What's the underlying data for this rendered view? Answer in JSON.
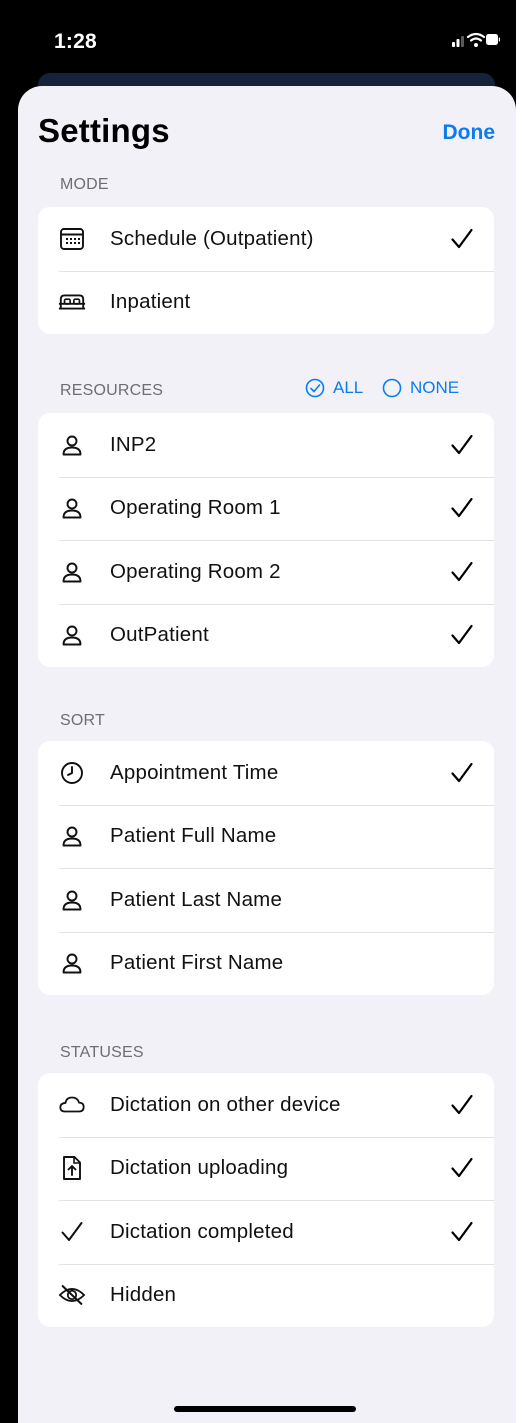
{
  "status_bar": {
    "time": "1:28"
  },
  "sheet": {
    "title": "Settings",
    "done_label": "Done"
  },
  "mode": {
    "header": "MODE",
    "items": [
      {
        "label": "Schedule (Outpatient)",
        "icon": "calendar-icon",
        "checked": true
      },
      {
        "label": "Inpatient",
        "icon": "bed-icon",
        "checked": false
      }
    ]
  },
  "resources": {
    "header": "RESOURCES",
    "all_label": "ALL",
    "none_label": "NONE",
    "items": [
      {
        "label": "INP2",
        "icon": "person-icon",
        "checked": true
      },
      {
        "label": "Operating Room 1",
        "icon": "person-icon",
        "checked": true
      },
      {
        "label": "Operating Room 2",
        "icon": "person-icon",
        "checked": true
      },
      {
        "label": "OutPatient",
        "icon": "person-icon",
        "checked": true
      }
    ]
  },
  "sort": {
    "header": "SORT",
    "items": [
      {
        "label": "Appointment Time",
        "icon": "clock-icon",
        "checked": true
      },
      {
        "label": "Patient Full Name",
        "icon": "person-icon",
        "checked": false
      },
      {
        "label": "Patient Last Name",
        "icon": "person-icon",
        "checked": false
      },
      {
        "label": "Patient First Name",
        "icon": "person-icon",
        "checked": false
      }
    ]
  },
  "statuses": {
    "header": "STATUSES",
    "items": [
      {
        "label": "Dictation on other device",
        "icon": "cloud-icon",
        "checked": true
      },
      {
        "label": "Dictation uploading",
        "icon": "upload-document-icon",
        "checked": true
      },
      {
        "label": "Dictation completed",
        "icon": "checkmark-icon",
        "checked": true
      },
      {
        "label": "Hidden",
        "icon": "eye-slash-icon",
        "checked": false
      }
    ]
  },
  "colors": {
    "accent": "#0a7cf0",
    "sheet_background": "#f2f1f7",
    "group_background": "#ffffff",
    "secondary_text": "#6d6d72"
  }
}
